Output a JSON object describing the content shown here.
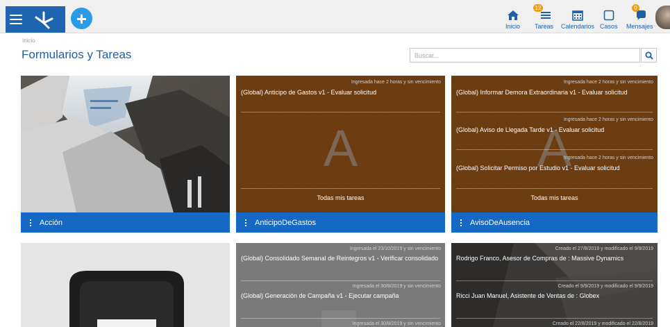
{
  "header": {
    "nav": [
      {
        "label": "Inicio",
        "icon": "home-icon"
      },
      {
        "label": "Tareas",
        "icon": "tasks-icon",
        "badge": "12"
      },
      {
        "label": "Calendarios",
        "icon": "calendar-icon"
      },
      {
        "label": "Casos",
        "icon": "case-icon"
      },
      {
        "label": "Mensajes",
        "icon": "messages-icon",
        "badge": "0"
      }
    ]
  },
  "breadcrumb": "Inicio",
  "page_title": "Formularios y Tareas",
  "search": {
    "placeholder": "Buscar..."
  },
  "cards": [
    {
      "footer": "Acción"
    },
    {
      "footer": "AnticipoDeGastos",
      "letter": "A",
      "tasks": [
        {
          "meta": "Ingresada hace 2 horas y sin vencimiento",
          "title": "(Global) Anticipo de Gastos v1 - Evaluar solicitud"
        }
      ],
      "all_tasks": "Todas mis tareas"
    },
    {
      "footer": "AvisoDeAusencia",
      "letter": "A",
      "tasks": [
        {
          "meta": "Ingresada hace 2 horas y sin vencimiento",
          "title": "(Global) Informar Demora Extraordinaria v1 - Evaluar solicitud"
        },
        {
          "meta": "Ingresada hace 2 horas y sin vencimiento",
          "title": "(Global) Aviso de Llegada Tarde v1 - Evaluar solicitud"
        },
        {
          "meta": "Ingresada hace 2 horas y sin vencimiento",
          "title": "(Global) Solicitar Permiso por Estudio v1 - Evaluar solicitud"
        }
      ],
      "all_tasks": "Todas mis tareas"
    },
    {
      "footer": ""
    },
    {
      "tasks": [
        {
          "meta": "Ingresada el 23/10/2019 y sin vencimiento",
          "title": "(Global) Consolidado Semanal de Reintegros v1 - Verificar consolidado"
        },
        {
          "meta": "Ingresada el 30/8/2019 y sin vencimiento",
          "title": "(Global) Generación de Campaña v1 - Ejecutar campaña"
        },
        {
          "meta": "Ingresada el 30/8/2019 y sin vencimiento",
          "title": ""
        }
      ]
    },
    {
      "tasks": [
        {
          "meta": "Creado el 27/8/2019 y modificado el 9/9/2019",
          "title": "Rodrigo Franco, Asesor de Compras de : Massive Dynamics"
        },
        {
          "meta": "Creado el 9/9/2019 y modificado el 9/9/2019",
          "title": "Ricci Juan Manuel, Asistente de Ventas de : Globex"
        },
        {
          "meta": "Creado el 22/8/2019 y modificado el 22/8/2019",
          "title": ""
        }
      ]
    }
  ],
  "colors": {
    "brand": "#1f64b0",
    "footer": "#1569c4",
    "accent": "#2b9be8",
    "badge": "#f39c12",
    "brown": "#6e3e12"
  }
}
